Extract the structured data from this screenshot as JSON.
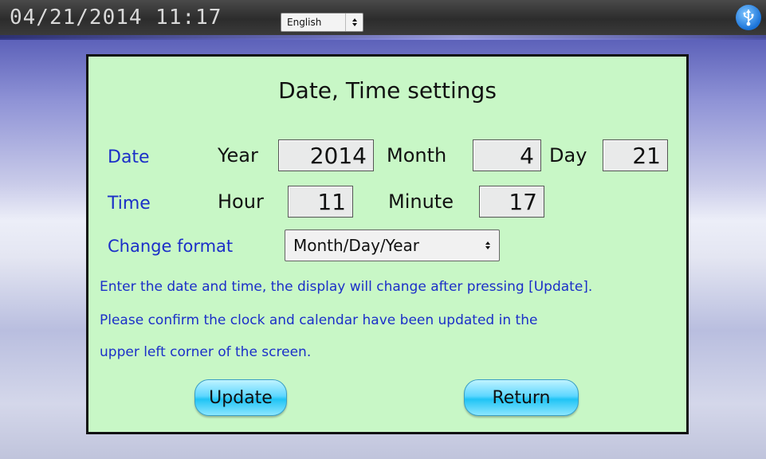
{
  "status_bar": {
    "datetime": "04/21/2014  11:17",
    "language_select": "English",
    "usb_icon": "usb-icon"
  },
  "dialog": {
    "title": "Date, Time settings",
    "date_label": "Date",
    "time_label": "Time",
    "year_label": "Year",
    "year_value": "2014",
    "month_label": "Month",
    "month_value": "4",
    "day_label": "Day",
    "day_value": "21",
    "hour_label": "Hour",
    "hour_value": "11",
    "minute_label": "Minute",
    "minute_value": "17",
    "format_label": "Change format",
    "format_value": "Month/Day/Year",
    "message_line1": "Enter the date and time, the display will change after pressing [Update].",
    "message_line2": "Please confirm the clock and calendar have been updated in the",
    "message_line3": "upper left corner of the screen.",
    "update_button": "Update",
    "return_button": "Return"
  },
  "colors": {
    "panel_bg": "#c8f7c6",
    "label_blue": "#1b2fc8",
    "button_cyan": "#20c4f5"
  }
}
